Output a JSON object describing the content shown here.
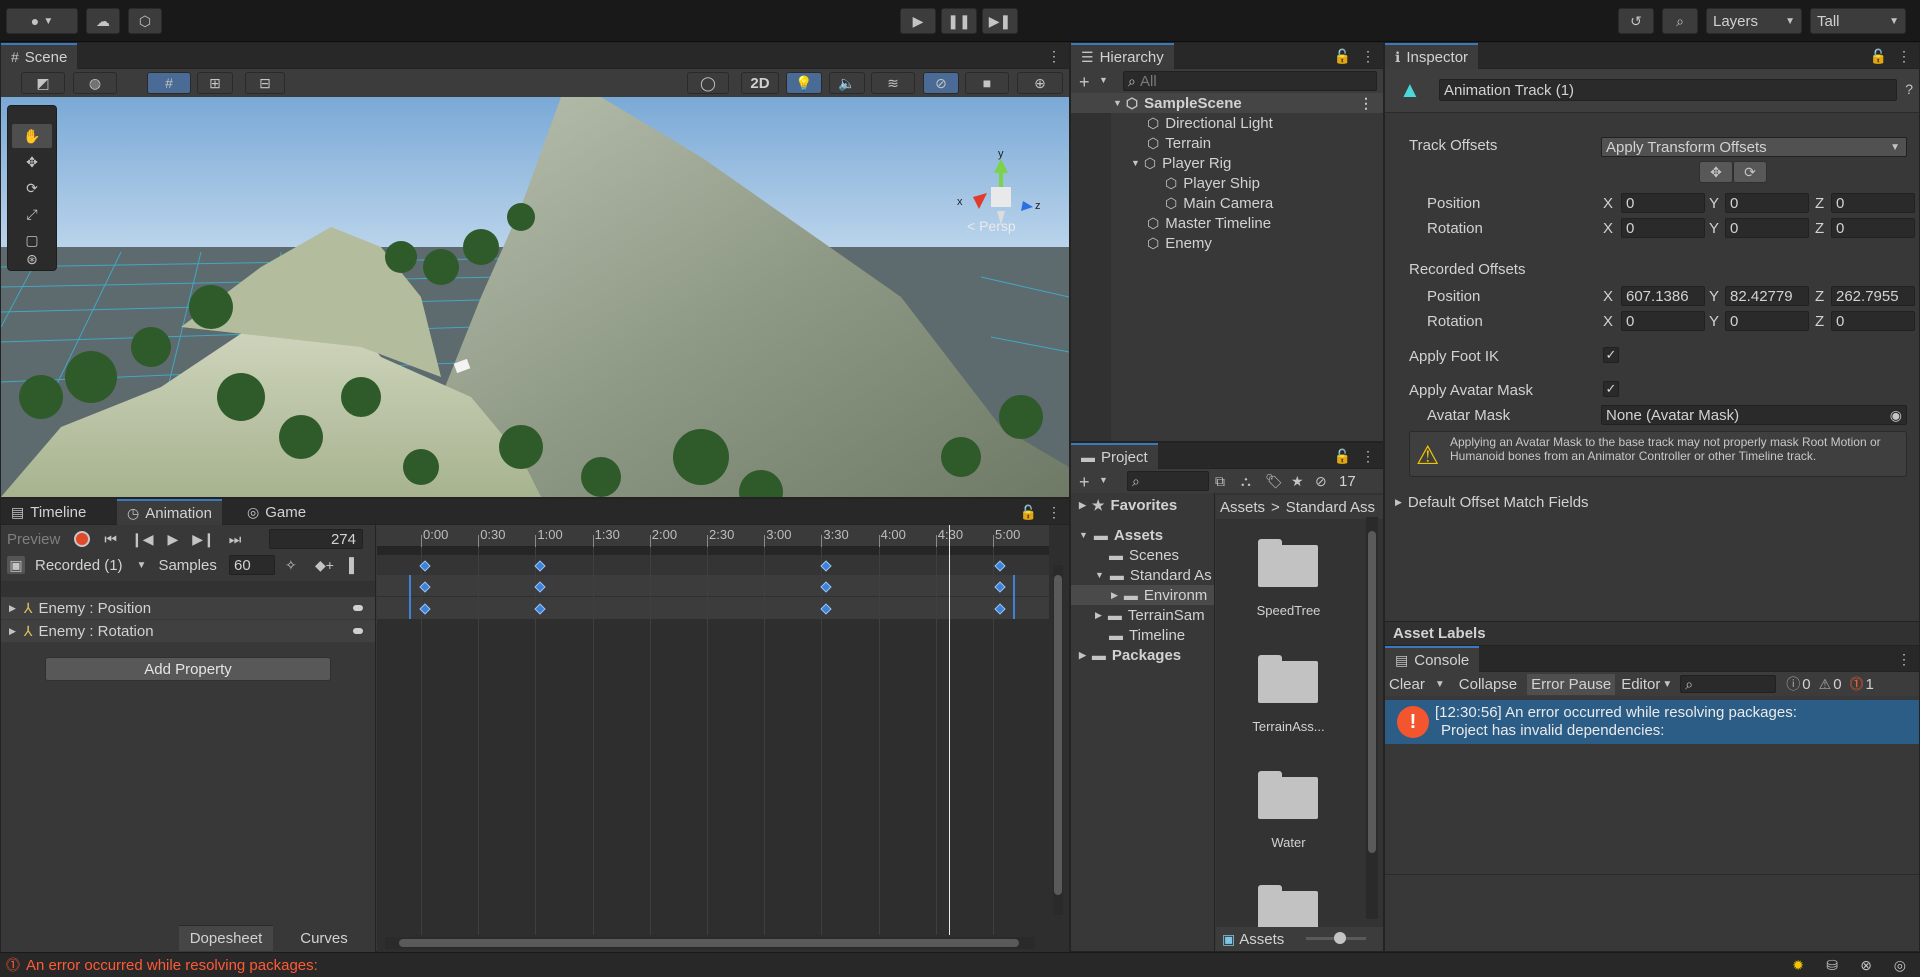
{
  "toolbar": {
    "layers_label": "Layers",
    "layout_label": "Tall"
  },
  "scene": {
    "tab": "Scene",
    "mode2d": "2D",
    "persp_label": "< Persp",
    "axis_x": "x",
    "axis_y": "y",
    "axis_z": "z"
  },
  "hierarchy": {
    "tab": "Hierarchy",
    "search_placeholder": "All",
    "items": [
      {
        "label": "SampleScene"
      },
      {
        "label": "Directional Light"
      },
      {
        "label": "Terrain"
      },
      {
        "label": "Player Rig"
      },
      {
        "label": "Player Ship"
      },
      {
        "label": "Main Camera"
      },
      {
        "label": "Master Timeline"
      },
      {
        "label": "Enemy"
      }
    ]
  },
  "inspector": {
    "tab": "Inspector",
    "object_name": "Animation Track (1)",
    "track_offsets_label": "Track Offsets",
    "track_offsets_value": "Apply Transform Offsets",
    "position_label": "Position",
    "rotation_label": "Rotation",
    "pos": {
      "x": "0",
      "y": "0",
      "z": "0"
    },
    "rot": {
      "x": "0",
      "y": "0",
      "z": "0"
    },
    "recorded_label": "Recorded Offsets",
    "rec_pos": {
      "x": "607.1386",
      "y": "82.42779",
      "z": "262.7955"
    },
    "rec_rot": {
      "x": "0",
      "y": "0",
      "z": "0"
    },
    "foot_ik_label": "Apply Foot IK",
    "avatar_mask_apply_label": "Apply Avatar Mask",
    "avatar_mask_label": "Avatar Mask",
    "avatar_mask_value": "None (Avatar Mask)",
    "warning": "Applying an Avatar Mask to the base track may not properly mask Root Motion or Humanoid bones from an Animator Controller or other Timeline track.",
    "default_offset_label": "Default Offset Match Fields",
    "asset_labels": "Asset Labels",
    "x": "X",
    "y": "Y",
    "z": "Z"
  },
  "console": {
    "tab": "Console",
    "clear": "Clear",
    "collapse": "Collapse",
    "error_pause": "Error Pause",
    "editor": "Editor",
    "count_info": "0",
    "count_warn": "0",
    "count_err": "1",
    "message_line1": "[12:30:56] An error occurred while resolving packages:",
    "message_line2": "Project has invalid dependencies:"
  },
  "project": {
    "tab": "Project",
    "hidden_count": "17",
    "favorites": "Favorites",
    "assets": "Assets",
    "scenes": "Scenes",
    "standard": "Standard As",
    "environment": "Environm",
    "terrain_sam": "TerrainSam",
    "timeline": "Timeline",
    "packages": "Packages",
    "breadcrumb_root": "Assets",
    "breadcrumb_child": "Standard Ass",
    "folders": [
      {
        "label": "SpeedTree"
      },
      {
        "label": "TerrainAss..."
      },
      {
        "label": "Water"
      }
    ],
    "footer": "Assets"
  },
  "animation": {
    "tab_timeline": "Timeline",
    "tab_animation": "Animation",
    "tab_game": "Game",
    "preview": "Preview",
    "frame": "274",
    "clip": "Recorded (1)",
    "samples_label": "Samples",
    "samples": "60",
    "properties": [
      {
        "label": "Enemy : Position"
      },
      {
        "label": "Enemy : Rotation"
      }
    ],
    "add_property": "Add Property",
    "dopesheet": "Dopesheet",
    "curves": "Curves",
    "ticks": [
      "0:00",
      "0:30",
      "1:00",
      "1:30",
      "2:00",
      "2:30",
      "3:00",
      "3:30",
      "4:00",
      "4:30",
      "5:00"
    ]
  },
  "status": {
    "error": "An error occurred while resolving packages:"
  }
}
